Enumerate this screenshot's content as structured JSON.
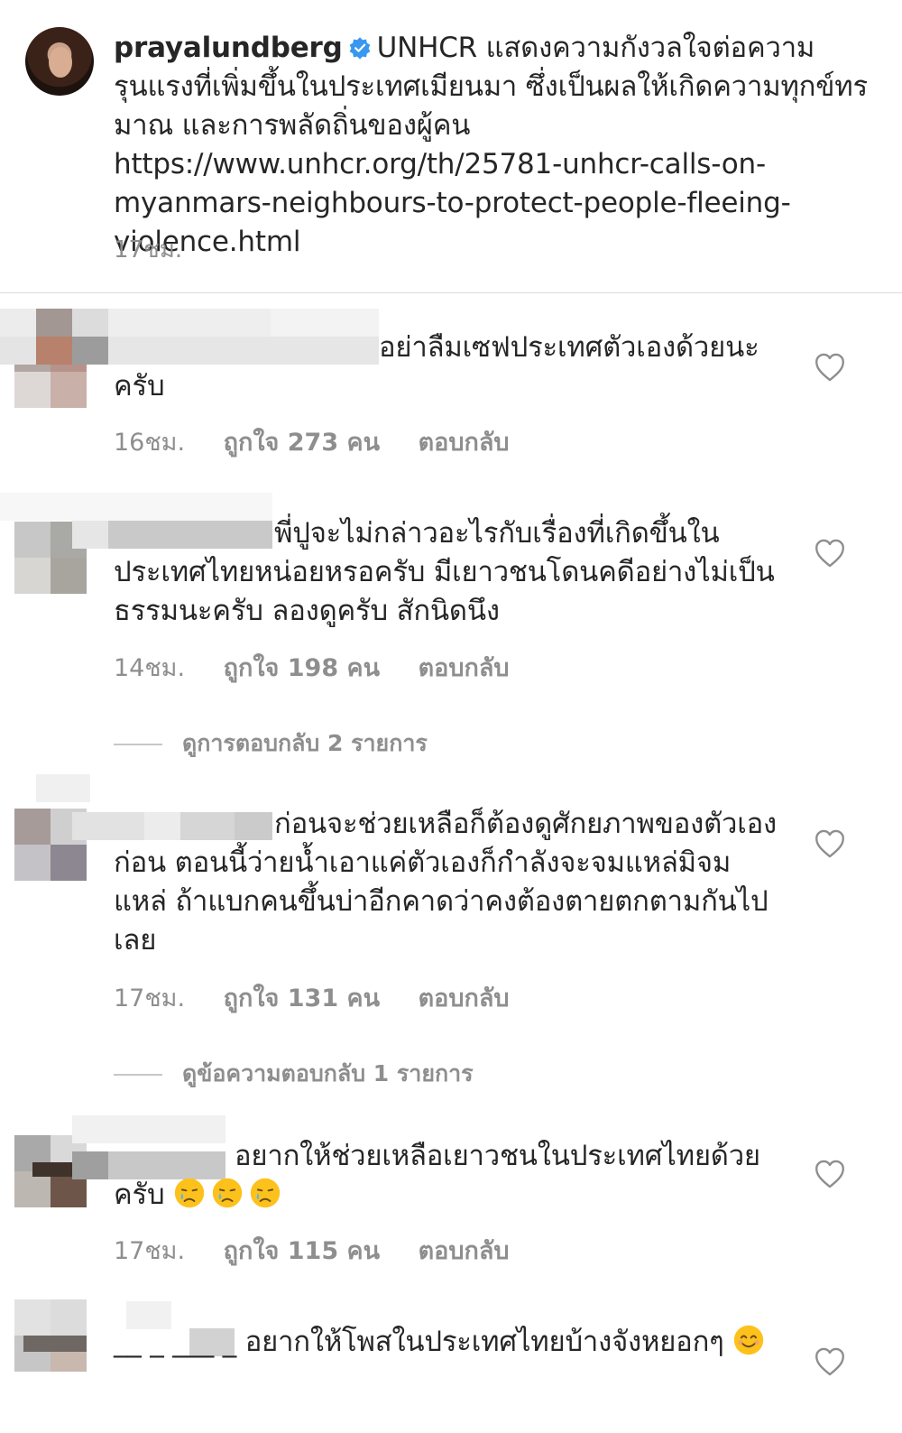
{
  "post": {
    "username": "prayalundberg",
    "caption": "UNHCR แสดงความกังวลใจต่อความรุนแรงที่เพิ่มขึ้นในประเทศเมียนมา ซึ่งเป็นผลให้เกิดความทุกข์ทรมาณ และการพลัดถิ่นของผู้คน https://www.unhcr.org/th/25781-unhcr-calls-on-myanmars-neighbours-to-protect-people-fleeing-violence.html",
    "time": "17ชม."
  },
  "comments": [
    {
      "text": "อย่าลืมเซฟประเทศตัวเองด้วยนะครับ",
      "time": "16ชม.",
      "likes": "ถูกใจ 273 คน",
      "reply": "ตอบกลับ"
    },
    {
      "text": "พี่ปูจะไม่กล่าวอะไรกับเรื่องที่เกิดขึ้นในประเทศไทยหน่อยหรอครับ มีเยาวชนโดนคดีอย่างไม่เป็นธรรมนะครับ ลองดูครับ สักนิดนึง",
      "time": "14ชม.",
      "likes": "ถูกใจ 198 คน",
      "reply": "ตอบกลับ",
      "view_replies": "ดูการตอบกลับ 2 รายการ"
    },
    {
      "text": "ก่อนจะช่วยเหลือก็ต้องดูศักยภาพของตัวเองก่อน ตอนนี้ว่ายน้ำเอาแค่ตัวเองก็กำลังจะจมแหล่มิจมแหล่ ถ้าแบกคนขึ้นบ่าอีกคาดว่าคงต้องตายตกตามกันไปเลย",
      "time": "17ชม.",
      "likes": "ถูกใจ 131 คน",
      "reply": "ตอบกลับ",
      "view_replies": "ดูข้อความตอบกลับ 1 รายการ"
    },
    {
      "text": "อยากให้ช่วยเหลือเยาวชนในประเทศไทยด้วยครับ",
      "emojis": [
        "crying-face-emoji",
        "crying-face-emoji",
        "crying-face-emoji"
      ],
      "time": "17ชม.",
      "likes": "ถูกใจ 115 คน",
      "reply": "ตอบกลับ"
    },
    {
      "text": "อยากให้โพสในประเทศไทยบ้างจังหยอกๆ",
      "emojis": [
        "smiling-face-emoji"
      ],
      "name_fragment": "__ _ ___ _"
    }
  ],
  "icons": {
    "verified": "verified-badge-icon",
    "like": "heart-outline-icon"
  },
  "colors": {
    "text": "#262626",
    "muted": "#8e8e8e",
    "verified": "#3897f0"
  }
}
